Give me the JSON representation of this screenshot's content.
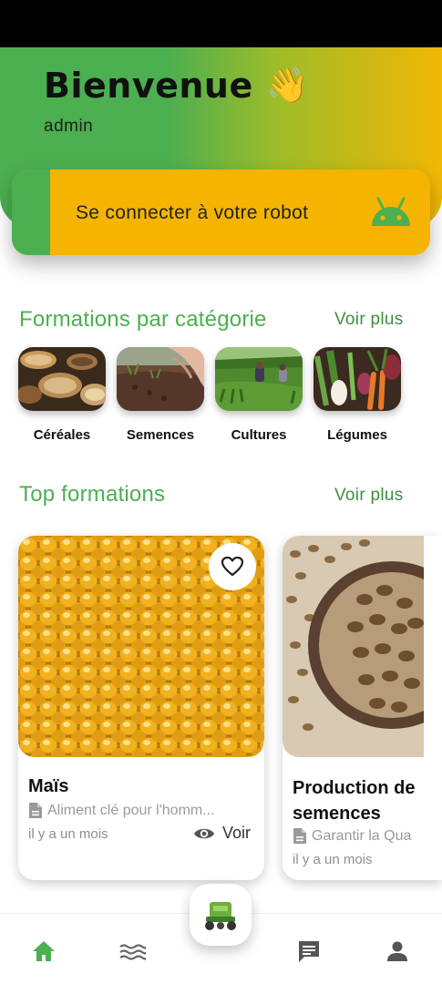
{
  "header": {
    "title": "Bienvenue",
    "wave_emoji": "👋",
    "username": "admin"
  },
  "robot_card": {
    "label": "Se connecter à votre robot",
    "icon": "android-icon"
  },
  "categories_section": {
    "title": "Formations par catégorie",
    "see_more": "Voir plus",
    "items": [
      {
        "label": "Céréales"
      },
      {
        "label": "Semences"
      },
      {
        "label": "Cultures"
      },
      {
        "label": "Légumes"
      }
    ]
  },
  "top_section": {
    "title": "Top formations",
    "see_more": "Voir plus",
    "cards": [
      {
        "title": "Maïs",
        "description": "Aliment clé pour l'homm...",
        "date": "il y a un mois",
        "view_label": "Voir"
      },
      {
        "title": "Production de semences",
        "description": "Garantir la Qua",
        "date": "il y a un mois"
      }
    ]
  },
  "colors": {
    "primary_green": "#4caf50",
    "accent_yellow": "#f5b400"
  },
  "bottom_nav": [
    "home-icon",
    "waves-icon",
    "robot-icon",
    "chat-icon",
    "person-icon"
  ]
}
